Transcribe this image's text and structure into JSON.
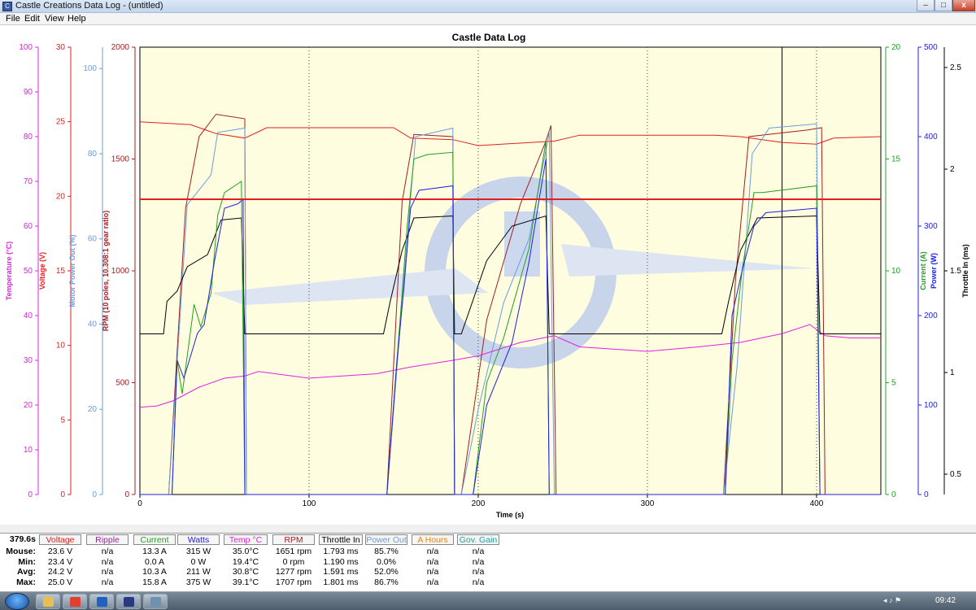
{
  "window": {
    "title": "Castle Creations Data Log - (untitled)",
    "minimize": "–",
    "maximize": "□",
    "close": "x"
  },
  "menu": [
    "File",
    "Edit",
    "View",
    "Help"
  ],
  "chart_data": {
    "type": "line",
    "title": "Castle Data Log",
    "xlabel": "Time (s)",
    "xlim": [
      0,
      438
    ],
    "x_ticks": [
      0,
      100,
      200,
      300,
      400
    ],
    "cursor_x": 379.6,
    "grid": true,
    "left_axes": [
      {
        "label": "Temperature (°C)",
        "color": "#e020e0",
        "ylim": [
          0,
          100
        ],
        "ticks": [
          0,
          10,
          20,
          30,
          40,
          50,
          60,
          70,
          80,
          90,
          100
        ]
      },
      {
        "label": "Voltage (V)",
        "color": "#e02020",
        "ylim": [
          0,
          30
        ],
        "ticks": [
          0,
          5,
          10,
          15,
          20,
          25,
          30
        ]
      },
      {
        "label": "Motor Power Out (%)",
        "color": "#6b9be0",
        "ylim": [
          0,
          105
        ],
        "ticks": [
          0,
          20,
          40,
          60,
          80,
          100
        ]
      },
      {
        "label": "RPM (10 poles, 10.308:1 gear ratio)",
        "color": "#a02020",
        "ylim": [
          0,
          2000
        ],
        "ticks": [
          0,
          500,
          1000,
          1500,
          2000
        ]
      }
    ],
    "right_axes": [
      {
        "label": "Current (A)",
        "color": "#20a020",
        "ylim": [
          0,
          20
        ],
        "ticks": [
          0,
          5,
          10,
          15,
          20
        ]
      },
      {
        "label": "Power (W)",
        "color": "#2020e0",
        "ylim": [
          0,
          500
        ],
        "ticks": [
          0,
          100,
          200,
          300,
          400,
          500
        ]
      },
      {
        "label": "Throttle In (ms)",
        "color": "#000000",
        "ylim": [
          0.4,
          2.6
        ],
        "ticks": [
          0.5,
          1.0,
          1.5,
          2.0,
          2.5
        ]
      }
    ],
    "series": [
      {
        "name": "Voltage",
        "color": "#e02020",
        "axis": "Voltage (V)",
        "points": [
          [
            0,
            25
          ],
          [
            30,
            24.8
          ],
          [
            45,
            24.2
          ],
          [
            62,
            23.9
          ],
          [
            75,
            24.6
          ],
          [
            150,
            24.6
          ],
          [
            160,
            23.9
          ],
          [
            185,
            23.8
          ],
          [
            200,
            23.4
          ],
          [
            245,
            23.7
          ],
          [
            260,
            24.1
          ],
          [
            340,
            24.1
          ],
          [
            355,
            24.0
          ],
          [
            380,
            23.6
          ],
          [
            400,
            23.5
          ],
          [
            410,
            23.9
          ],
          [
            438,
            24.0
          ]
        ]
      },
      {
        "name": "RPM",
        "color": "#a02020",
        "axis": "RPM (10 poles, 10.308:1 gear ratio)",
        "points": [
          [
            0,
            0
          ],
          [
            17,
            0
          ],
          [
            27,
            1280
          ],
          [
            35,
            1600
          ],
          [
            45,
            1700
          ],
          [
            62,
            1680
          ],
          [
            63,
            0
          ],
          [
            146,
            0
          ],
          [
            155,
            1310
          ],
          [
            162,
            1610
          ],
          [
            185,
            1600
          ],
          [
            186,
            0
          ],
          [
            190,
            0
          ],
          [
            205,
            780
          ],
          [
            225,
            1300
          ],
          [
            240,
            1580
          ],
          [
            243,
            1650
          ],
          [
            246,
            0
          ],
          [
            345,
            0
          ],
          [
            352,
            950
          ],
          [
            360,
            1600
          ],
          [
            395,
            1630
          ],
          [
            403,
            1640
          ],
          [
            405,
            0
          ],
          [
            438,
            0
          ]
        ]
      },
      {
        "name": "Power Out",
        "color": "#6b9be0",
        "axis": "Motor Power Out (%)",
        "points": [
          [
            0,
            0
          ],
          [
            17,
            0
          ],
          [
            28,
            68
          ],
          [
            42,
            75
          ],
          [
            46,
            85
          ],
          [
            62,
            86
          ],
          [
            63,
            0
          ],
          [
            146,
            0
          ],
          [
            156,
            50
          ],
          [
            163,
            84
          ],
          [
            185,
            86
          ],
          [
            186,
            0
          ],
          [
            190,
            0
          ],
          [
            200,
            20
          ],
          [
            215,
            45
          ],
          [
            230,
            60
          ],
          [
            242,
            85
          ],
          [
            245,
            0
          ],
          [
            345,
            0
          ],
          [
            353,
            30
          ],
          [
            362,
            80
          ],
          [
            372,
            86
          ],
          [
            400,
            87
          ],
          [
            402,
            0
          ],
          [
            438,
            0
          ]
        ]
      },
      {
        "name": "Temp",
        "color": "#e020e0",
        "axis": "Temperature (°C)",
        "points": [
          [
            0,
            19.5
          ],
          [
            10,
            19.8
          ],
          [
            20,
            21
          ],
          [
            35,
            24
          ],
          [
            50,
            26
          ],
          [
            62,
            26.5
          ],
          [
            70,
            27.5
          ],
          [
            100,
            26
          ],
          [
            140,
            27
          ],
          [
            160,
            28.5
          ],
          [
            185,
            30
          ],
          [
            200,
            31
          ],
          [
            225,
            34
          ],
          [
            245,
            35.5
          ],
          [
            260,
            33
          ],
          [
            300,
            32
          ],
          [
            330,
            33
          ],
          [
            355,
            34
          ],
          [
            380,
            36
          ],
          [
            396,
            38
          ],
          [
            405,
            35.5
          ],
          [
            420,
            35
          ],
          [
            438,
            35
          ]
        ]
      },
      {
        "name": "Throttle In",
        "color": "#000000",
        "axis": "Throttle In (ms)",
        "points": [
          [
            0,
            1.19
          ],
          [
            14,
            1.19
          ],
          [
            16,
            1.35
          ],
          [
            22,
            1.4
          ],
          [
            28,
            1.52
          ],
          [
            40,
            1.58
          ],
          [
            48,
            1.75
          ],
          [
            60,
            1.76
          ],
          [
            62,
            1.19
          ],
          [
            144,
            1.19
          ],
          [
            148,
            1.35
          ],
          [
            155,
            1.6
          ],
          [
            162,
            1.76
          ],
          [
            185,
            1.77
          ],
          [
            186,
            1.19
          ],
          [
            190,
            1.19
          ],
          [
            205,
            1.55
          ],
          [
            220,
            1.72
          ],
          [
            240,
            1.77
          ],
          [
            242,
            1.19
          ],
          [
            344,
            1.19
          ],
          [
            348,
            1.35
          ],
          [
            355,
            1.6
          ],
          [
            365,
            1.76
          ],
          [
            400,
            1.77
          ],
          [
            402,
            1.19
          ],
          [
            438,
            1.19
          ]
        ]
      },
      {
        "name": "Current",
        "color": "#20a020",
        "axis": "Current (A)",
        "points": [
          [
            0,
            0
          ],
          [
            19,
            0
          ],
          [
            22,
            6
          ],
          [
            25,
            4.5
          ],
          [
            32,
            8.5
          ],
          [
            36,
            7.5
          ],
          [
            42,
            9
          ],
          [
            46,
            12.5
          ],
          [
            50,
            13.5
          ],
          [
            60,
            14
          ],
          [
            62,
            0
          ],
          [
            146,
            0
          ],
          [
            152,
            6
          ],
          [
            155,
            9
          ],
          [
            158,
            12
          ],
          [
            162,
            15
          ],
          [
            170,
            15.2
          ],
          [
            185,
            15.3
          ],
          [
            186,
            0
          ],
          [
            197,
            0
          ],
          [
            205,
            5
          ],
          [
            215,
            7
          ],
          [
            230,
            11
          ],
          [
            240,
            15.8
          ],
          [
            242,
            0
          ],
          [
            346,
            0
          ],
          [
            350,
            6
          ],
          [
            356,
            10
          ],
          [
            363,
            13.5
          ],
          [
            368,
            13.5
          ],
          [
            400,
            13.8
          ],
          [
            402,
            0
          ],
          [
            438,
            0
          ]
        ]
      },
      {
        "name": "Watts",
        "color": "#2020e0",
        "axis": "Power (W)",
        "points": [
          [
            0,
            0
          ],
          [
            19,
            0
          ],
          [
            22,
            150
          ],
          [
            26,
            130
          ],
          [
            34,
            180
          ],
          [
            38,
            190
          ],
          [
            44,
            260
          ],
          [
            50,
            320
          ],
          [
            58,
            325
          ],
          [
            61,
            330
          ],
          [
            62,
            0
          ],
          [
            146,
            0
          ],
          [
            152,
            150
          ],
          [
            156,
            230
          ],
          [
            160,
            320
          ],
          [
            165,
            340
          ],
          [
            185,
            345
          ],
          [
            186,
            0
          ],
          [
            197,
            0
          ],
          [
            205,
            100
          ],
          [
            220,
            170
          ],
          [
            230,
            260
          ],
          [
            236,
            330
          ],
          [
            240,
            375
          ],
          [
            242,
            0
          ],
          [
            346,
            0
          ],
          [
            350,
            200
          ],
          [
            356,
            250
          ],
          [
            363,
            300
          ],
          [
            370,
            315
          ],
          [
            400,
            320
          ],
          [
            402,
            0
          ],
          [
            438,
            0
          ]
        ]
      },
      {
        "name": "Reference line",
        "color": "#e02020",
        "axis": "Voltage (V)",
        "points": [
          [
            0,
            19.8
          ],
          [
            438,
            19.8
          ]
        ]
      }
    ]
  },
  "table": {
    "time": "379.6s",
    "headers": [
      {
        "label": "Voltage",
        "color": "#e02020"
      },
      {
        "label": "Ripple",
        "color": "#a020a0"
      },
      {
        "label": "Current",
        "color": "#20a020"
      },
      {
        "label": "Watts",
        "color": "#2020e0"
      },
      {
        "label": "Temp °C",
        "color": "#e020e0"
      },
      {
        "label": "RPM",
        "color": "#a02020"
      },
      {
        "label": "Throttle In",
        "color": "#000000"
      },
      {
        "label": "Power Out",
        "color": "#6b9be0"
      },
      {
        "label": "A Hours",
        "color": "#f08000"
      },
      {
        "label": "Gov. Gain",
        "color": "#20a0a0"
      }
    ],
    "rows": [
      {
        "label": "Mouse:",
        "values": [
          "23.6 V",
          "n/a",
          "13.3 A",
          "315 W",
          "35.0°C",
          "1651 rpm",
          "1.793 ms",
          "85.7%",
          "n/a",
          "n/a"
        ]
      },
      {
        "label": "Min:",
        "values": [
          "23.4 V",
          "n/a",
          "0.0 A",
          "0 W",
          "19.4°C",
          "0 rpm",
          "1.190 ms",
          "0.0%",
          "n/a",
          "n/a"
        ]
      },
      {
        "label": "Avg:",
        "values": [
          "24.2 V",
          "n/a",
          "10.3 A",
          "211 W",
          "30.8°C",
          "1277 rpm",
          "1.591 ms",
          "52.0%",
          "n/a",
          "n/a"
        ]
      },
      {
        "label": "Max:",
        "values": [
          "25.0 V",
          "n/a",
          "15.8 A",
          "375 W",
          "39.1°C",
          "1707 rpm",
          "1.801 ms",
          "86.7%",
          "n/a",
          "n/a"
        ]
      }
    ]
  },
  "taskbar": {
    "clock": "09:42",
    "tray": "◂ ♪ ⚑",
    "apps": [
      {
        "name": "explorer",
        "color": "#e8c050"
      },
      {
        "name": "chrome",
        "color": "#e04030"
      },
      {
        "name": "outlook",
        "color": "#2060c0"
      },
      {
        "name": "castle-link",
        "color": "#2a3a80"
      },
      {
        "name": "window",
        "color": "#7090b0"
      }
    ]
  }
}
